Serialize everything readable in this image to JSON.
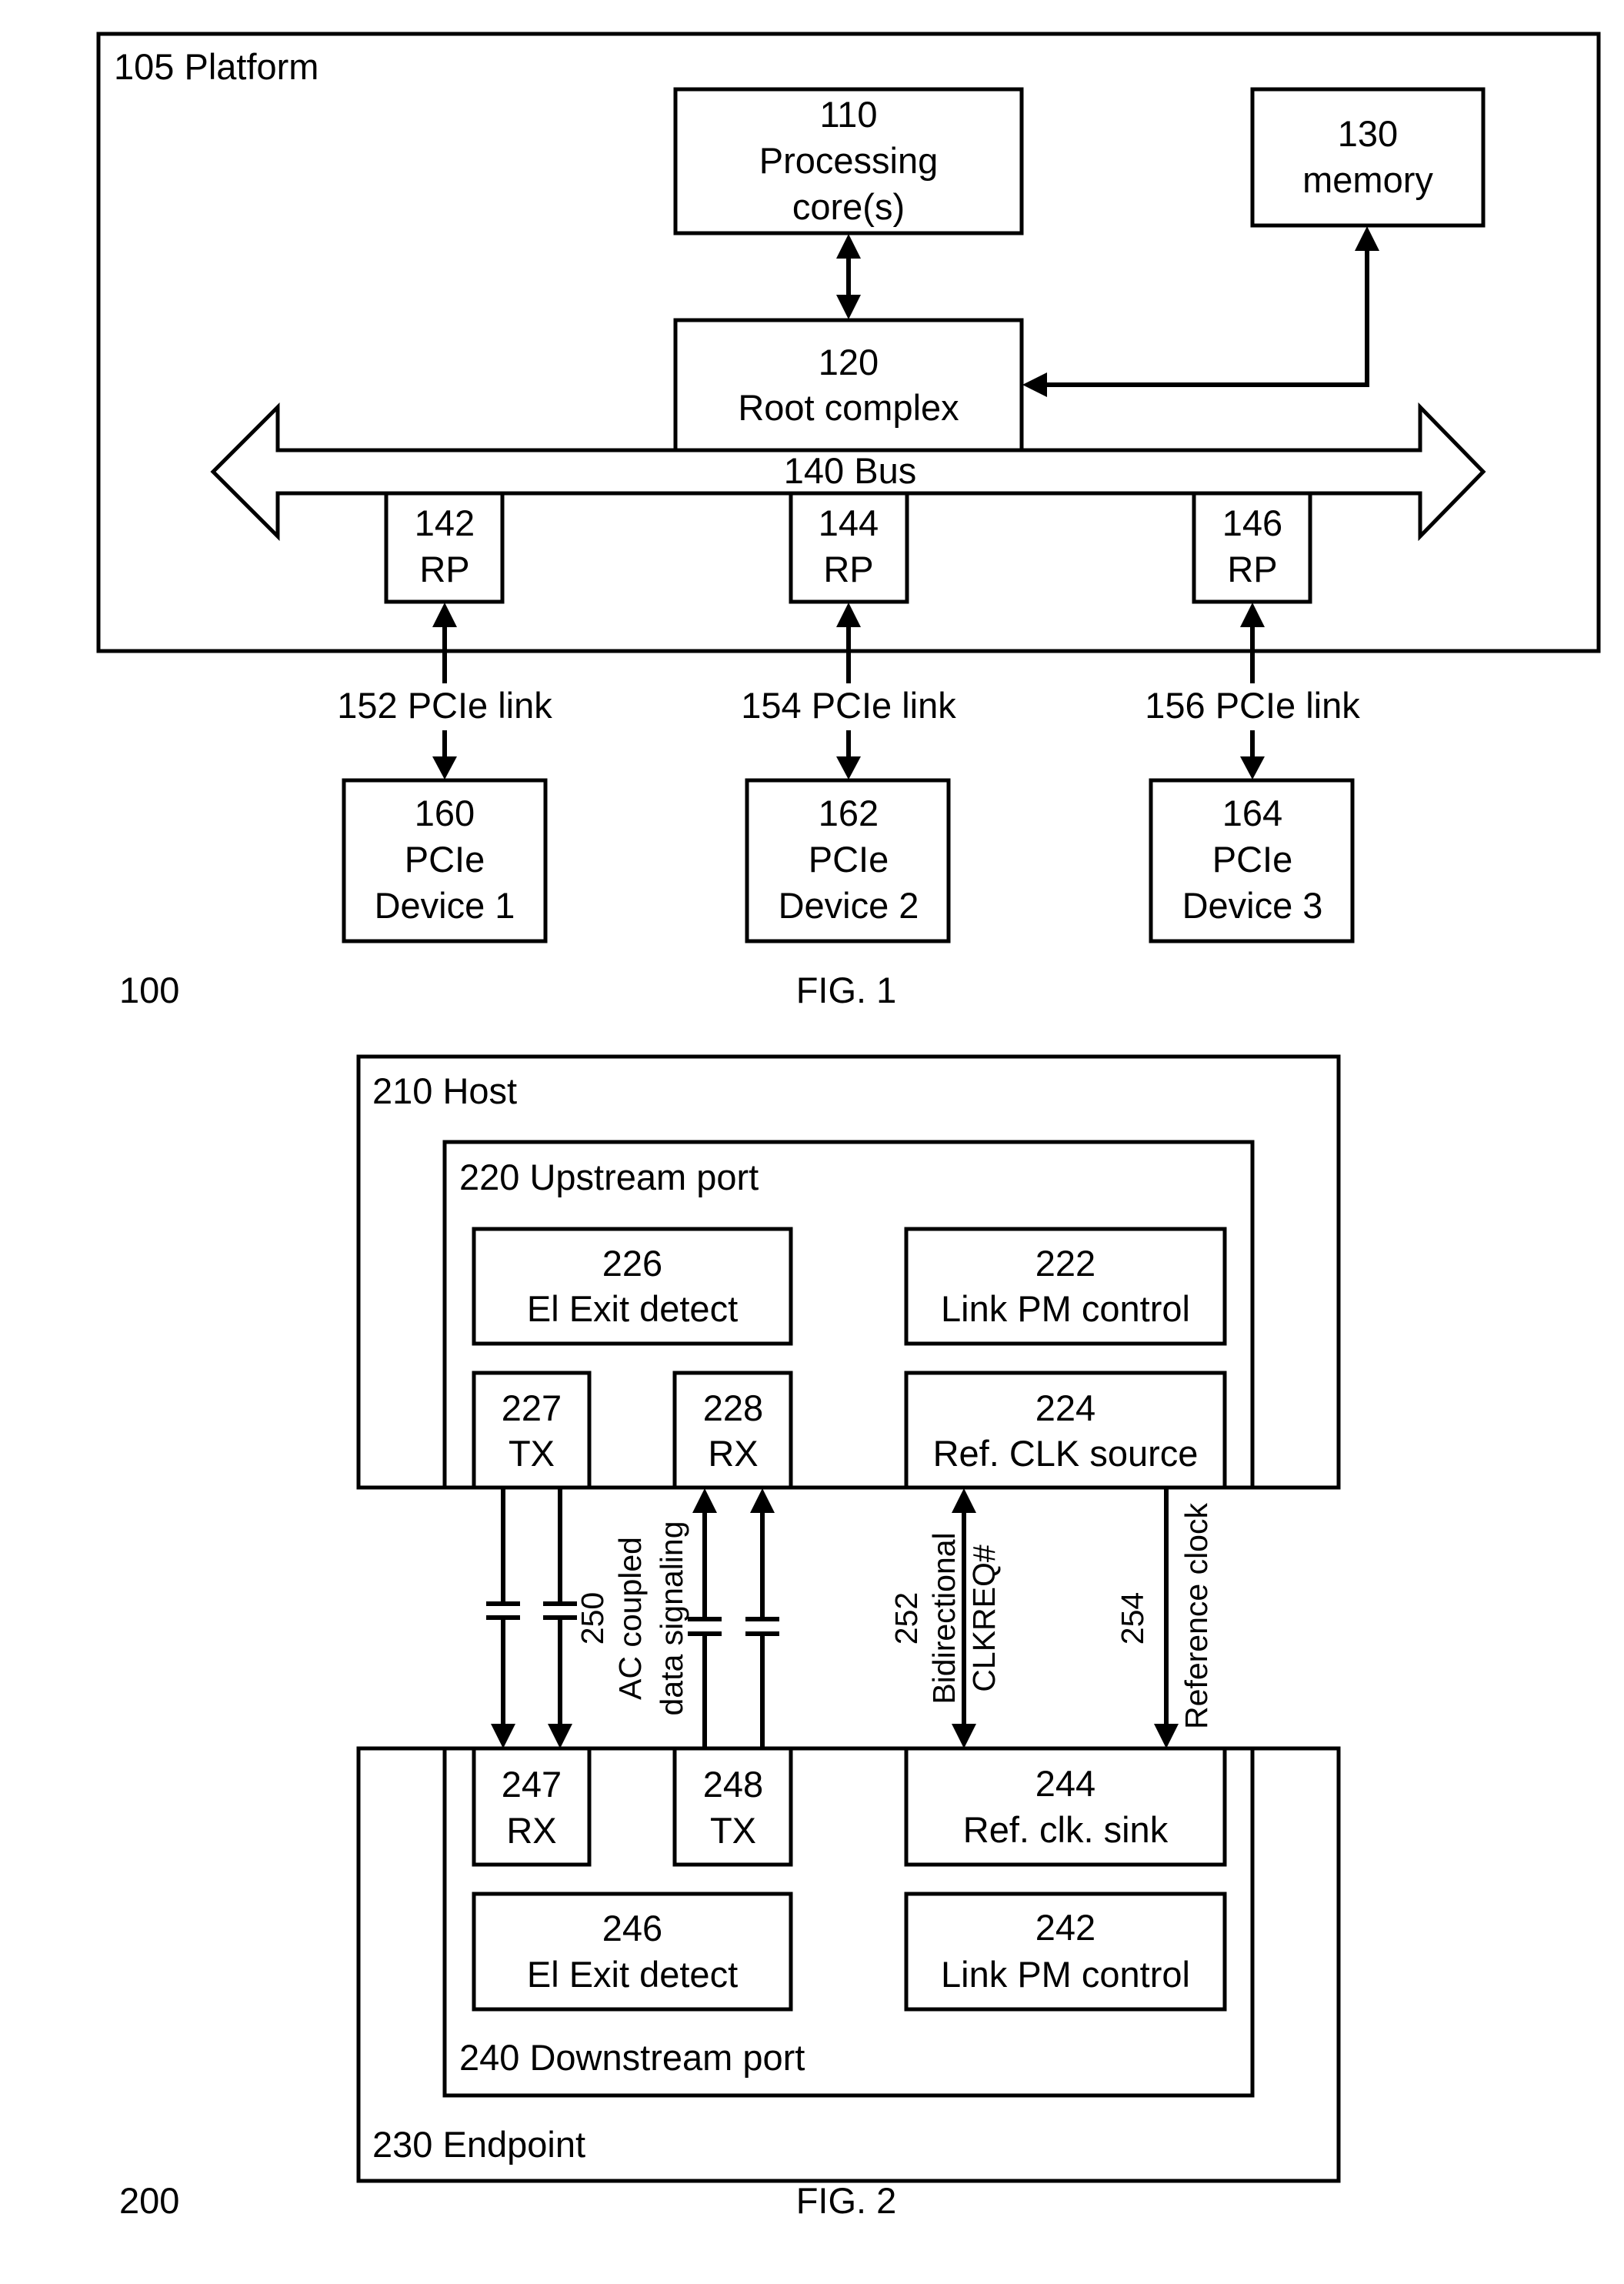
{
  "fig1": {
    "ref": "100",
    "caption": "FIG. 1",
    "platform_label": "105 Platform",
    "processing": {
      "num": "110",
      "line1": "Processing",
      "line2": "core(s)"
    },
    "memory": {
      "num": "130",
      "label": "memory"
    },
    "root_complex": {
      "num": "120",
      "label": "Root complex"
    },
    "bus_label": "140 Bus",
    "root_ports": [
      {
        "num": "142",
        "label": "RP"
      },
      {
        "num": "144",
        "label": "RP"
      },
      {
        "num": "146",
        "label": "RP"
      }
    ],
    "links": [
      "152 PCIe link",
      "154 PCIe link",
      "156 PCIe link"
    ],
    "devices": [
      {
        "num": "160",
        "line1": "PCIe",
        "line2": "Device 1"
      },
      {
        "num": "162",
        "line1": "PCIe",
        "line2": "Device 2"
      },
      {
        "num": "164",
        "line1": "PCIe",
        "line2": "Device 3"
      }
    ]
  },
  "fig2": {
    "ref": "200",
    "caption": "FIG. 2",
    "host_label": "210 Host",
    "upstream_label": "220 Upstream port",
    "endpoint_label": "230 Endpoint",
    "downstream_label": "240 Downstream port",
    "upstream": {
      "ei_exit": {
        "num": "226",
        "label": "El Exit detect"
      },
      "link_pm": {
        "num": "222",
        "label": "Link PM control"
      },
      "tx": {
        "num": "227",
        "label": "TX"
      },
      "rx": {
        "num": "228",
        "label": "RX"
      },
      "clk_source": {
        "num": "224",
        "label": "Ref. CLK source"
      }
    },
    "downstream": {
      "rx": {
        "num": "247",
        "label": "RX"
      },
      "tx": {
        "num": "248",
        "label": "TX"
      },
      "clk_sink": {
        "num": "244",
        "label": "Ref. clk. sink"
      },
      "ei_exit": {
        "num": "246",
        "label": "El Exit detect"
      },
      "link_pm": {
        "num": "242",
        "label": "Link PM control"
      }
    },
    "signals": {
      "data": {
        "num": "250",
        "line1": "AC coupled",
        "line2": "data signaling"
      },
      "clkreq": {
        "num": "252",
        "line1": "Bidirectional",
        "line2": "CLKREQ#"
      },
      "refclk": {
        "num": "254",
        "label": "Reference clock"
      }
    }
  }
}
